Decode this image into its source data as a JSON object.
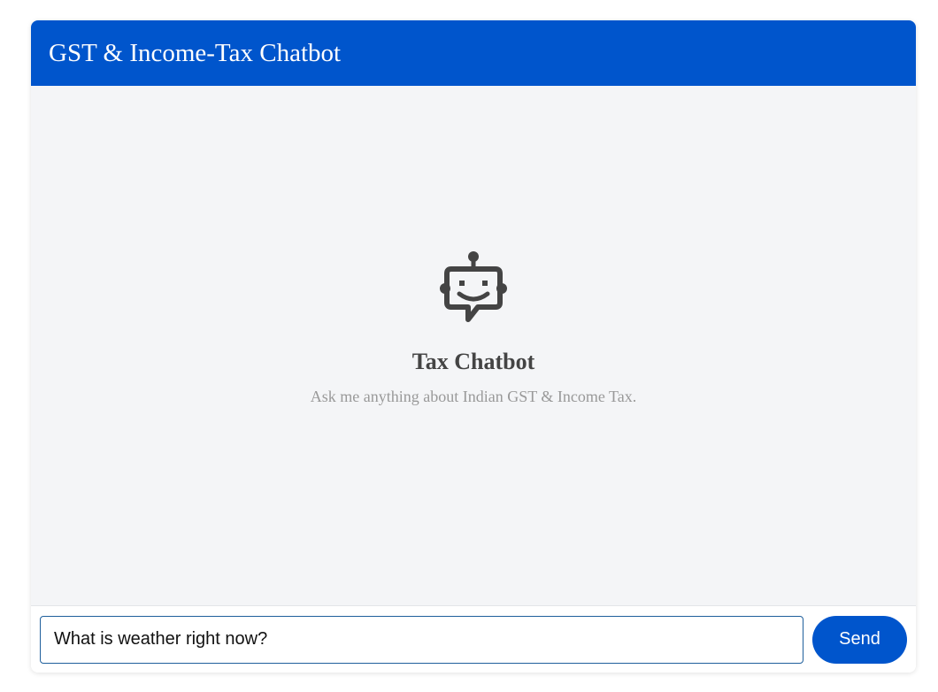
{
  "header": {
    "title": "GST & Income-Tax Chatbot"
  },
  "empty_state": {
    "icon": "robot-chat-icon",
    "title": "Tax Chatbot",
    "subtitle": "Ask me anything about Indian GST & Income Tax."
  },
  "composer": {
    "input_value": "What is weather right now?",
    "send_label": "Send"
  },
  "colors": {
    "brand": "#0055cc",
    "chat_background": "#f4f5f7",
    "icon": "#444444"
  }
}
